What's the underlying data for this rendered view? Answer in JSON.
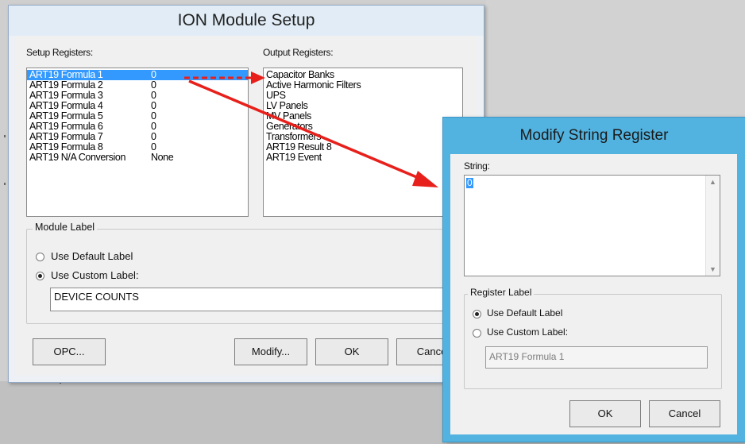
{
  "colors": {
    "selection": "#3399ff",
    "arrow": "#e8201b",
    "modify_dialog_frame": "#53b3e0"
  },
  "main_dialog": {
    "title": "ION Module Setup",
    "setup_registers_label": "Setup Registers:",
    "output_registers_label": "Output Registers:",
    "setup_registers": [
      {
        "name": "ART19 Formula 1",
        "value": "0",
        "selected": true
      },
      {
        "name": "ART19 Formula 2",
        "value": "0"
      },
      {
        "name": "ART19 Formula 3",
        "value": "0"
      },
      {
        "name": "ART19 Formula 4",
        "value": "0"
      },
      {
        "name": "ART19 Formula 5",
        "value": "0"
      },
      {
        "name": "ART19 Formula 6",
        "value": "0"
      },
      {
        "name": "ART19 Formula 7",
        "value": "0"
      },
      {
        "name": "ART19 Formula 8",
        "value": "0"
      },
      {
        "name": "ART19 N/A Conversion",
        "value": "None"
      }
    ],
    "output_registers": [
      "Capacitor Banks",
      "Active Harmonic Filters",
      "UPS",
      "LV Panels",
      "MV Panels",
      "Generators",
      "Transformers",
      "ART19 Result 8",
      "ART19 Event"
    ],
    "module_label_group": "Module Label",
    "use_default_label": "Use Default Label",
    "use_custom_label": "Use Custom Label:",
    "selected_option": "custom",
    "custom_label_value": "DEVICE COUNTS",
    "buttons": {
      "opc": "OPC...",
      "modify": "Modify...",
      "ok": "OK",
      "cancel": "Cancel"
    }
  },
  "modify_dialog": {
    "title": "Modify String Register",
    "string_label": "String:",
    "string_value": "0",
    "register_label_group": "Register Label",
    "use_default_label": "Use Default Label",
    "use_custom_label": "Use Custom Label:",
    "selected_option": "default",
    "custom_label_value": "ART19 Formula 1",
    "buttons": {
      "ok": "OK",
      "cancel": "Cancel"
    }
  },
  "icons": {
    "scroll_up": "scroll-up-arrow-icon",
    "scroll_down": "scroll-down-arrow-icon",
    "annotation_arrows": "red-arrow-icon"
  }
}
